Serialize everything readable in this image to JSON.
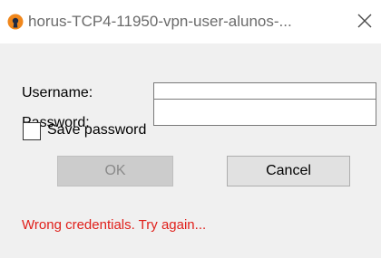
{
  "window": {
    "title": "horus-TCP4-11950-vpn-user-alunos-...",
    "app_icon": "openvpn-icon",
    "close_glyph": "✕"
  },
  "form": {
    "username_label": "Username:",
    "username_value": "",
    "password_label": "Password:",
    "password_value": "",
    "save_password_label": "Save password",
    "save_password_checked": false
  },
  "buttons": {
    "ok_label": "OK",
    "ok_enabled": false,
    "cancel_label": "Cancel"
  },
  "status": {
    "error_message": "Wrong credentials. Try again..."
  },
  "colors": {
    "error": "#e0201b",
    "icon_orange": "#f0871c",
    "icon_dark": "#1f2a44",
    "dialog_background": "#f0f0f0"
  }
}
